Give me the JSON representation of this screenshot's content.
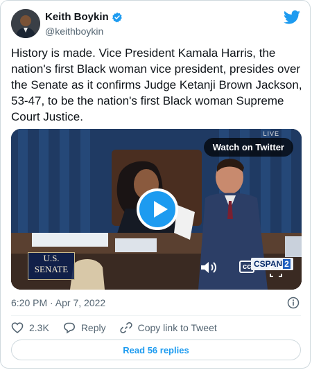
{
  "author": {
    "name": "Keith Boykin",
    "handle": "@keithboykin"
  },
  "tweet": {
    "text": "History is made. Vice President Kamala Harris, the nation's first Black woman vice president, presides over the Senate as it confirms Judge Ketanji Brown Jackson, 53-47, to be the nation's first Black woman Supreme Court Justice.",
    "timestamp": "6:20 PM · Apr 7, 2022"
  },
  "media": {
    "watch_label": "Watch on Twitter",
    "live_label": "LIVE",
    "senate_logo": [
      "U.S.",
      "SENATE"
    ],
    "cc_label": "cc",
    "network_label": "SPAN",
    "network_number": "2",
    "network_prefix": "C"
  },
  "actions": {
    "like_count": "2.3K",
    "reply_label": "Reply",
    "copy_label": "Copy link to Tweet"
  },
  "read_replies": "Read 56 replies",
  "colors": {
    "accent": "#1d9bf0",
    "text": "#0f1419",
    "muted": "#536471"
  }
}
